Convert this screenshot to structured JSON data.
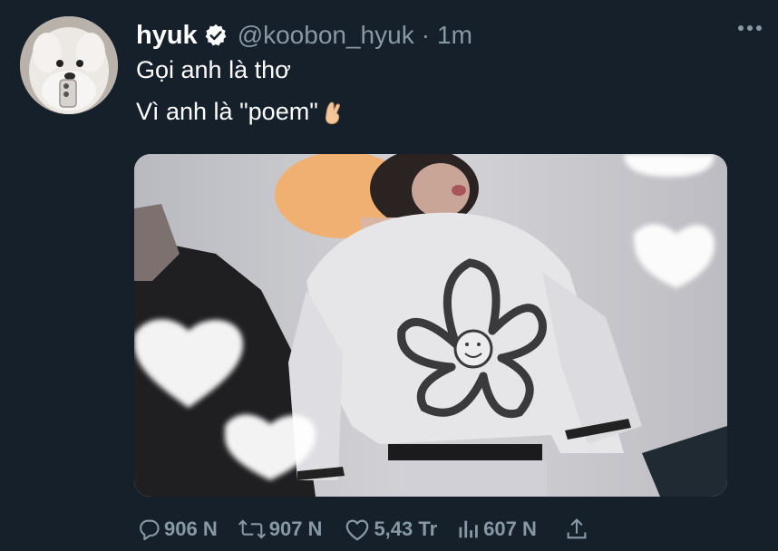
{
  "tweet": {
    "display_name": "hyuk",
    "verified_icon": "verified-badge-icon",
    "handle": "@koobon_hyuk",
    "separator": "·",
    "time": "1m",
    "more_icon": "more-dots-icon",
    "lines": [
      "Gọi anh là thơ",
      "Vì anh là \"poem\""
    ],
    "emoji": "crossed-fingers-icon"
  },
  "media": {
    "kind": "video-still",
    "description_icons": [
      "heart-sticker-icon"
    ]
  },
  "actions": {
    "reply_count": "906 N",
    "retweet_count": "907 N",
    "like_count": "5,43 Tr",
    "views_count": "607 N",
    "share_icon": "share-icon"
  },
  "colors": {
    "background": "#15202b",
    "text": "#ffffff",
    "secondary": "#8899a6"
  }
}
